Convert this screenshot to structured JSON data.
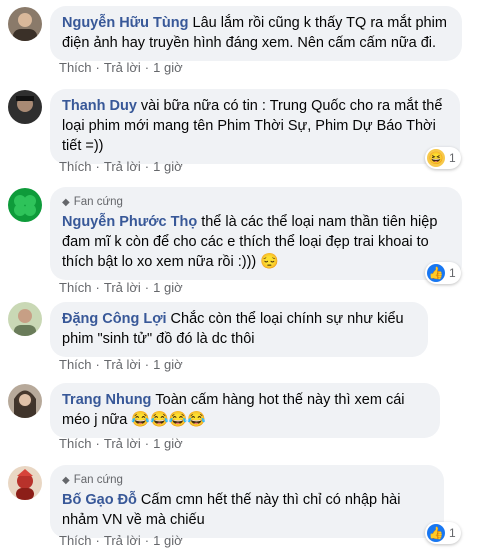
{
  "comments": [
    {
      "author": "Nguyễn Hữu Tùng",
      "text": "Lâu lắm rồi cũng k thấy TQ ra mắt phim điện ảnh hay truyền hình đáng xem. Nên cấm cấm nữa đi.",
      "like": "Thích",
      "reply": "Trả lời",
      "time": "1 giờ",
      "avatar_icon": "person-photo-avatar"
    },
    {
      "author": "Thanh Duy",
      "text": "vài bữa nữa có tin : Trung Quốc cho ra mắt thể loại phim mới mang tên Phim Thời Sự, Phim Dự Báo Thời tiết =))",
      "like": "Thích",
      "reply": "Trả lời",
      "time": "1 giờ",
      "reaction": {
        "icon": "haha-reaction-icon",
        "count": "1"
      },
      "avatar_icon": "person-photo-avatar"
    },
    {
      "badge": "Fan cứng",
      "author": "Nguyễn Phước Thọ",
      "text": "thể là các thể loại nam thần tiên hiệp đam mĩ k còn để cho các e thích thể loại đẹp trai khoai to thích bật lo xo xem nữa rồi :)))",
      "emoji": "😔",
      "like": "Thích",
      "reply": "Trả lời",
      "time": "1 giờ",
      "reaction": {
        "icon": "like-reaction-icon",
        "count": "1"
      },
      "avatar_icon": "clover-avatar"
    },
    {
      "author": "Đặng Công Lợi",
      "text": "Chắc còn thể loại chính sự như kiểu phim \"sinh tử\" đồ đó là dc thôi",
      "like": "Thích",
      "reply": "Trả lời",
      "time": "1 giờ",
      "avatar_icon": "person-photo-avatar"
    },
    {
      "author": "Trang Nhung",
      "text": "Toàn cấm hàng hot thế này thì xem cái méo j nữa",
      "emoji": "😂😂😂😂",
      "like": "Thích",
      "reply": "Trả lời",
      "time": "1 giờ",
      "avatar_icon": "person-photo-avatar"
    },
    {
      "badge": "Fan cứng",
      "author": "Bố Gạo Đỗ",
      "text": "Cấm cmn hết thế này thì chỉ có nhập hài nhảm VN về mà chiếu",
      "like": "Thích",
      "reply": "Trả lời",
      "time": "1 giờ",
      "reaction": {
        "icon": "like-reaction-icon",
        "count": "1"
      },
      "avatar_icon": "person-photo-avatar"
    }
  ],
  "colors": {
    "author": "#385898",
    "bubble": "#f0f2f5",
    "meta": "#65676b"
  }
}
